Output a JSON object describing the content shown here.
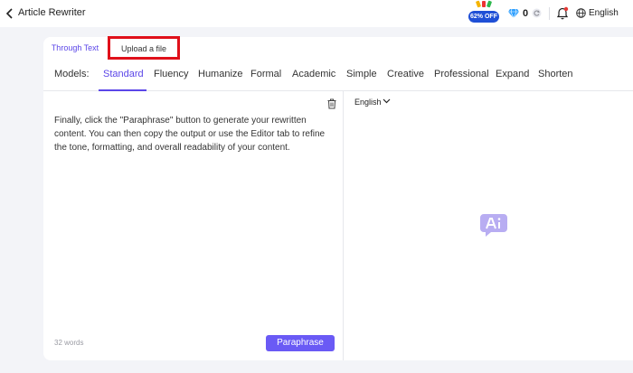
{
  "header": {
    "title": "Article Rewriter",
    "promo_label": "62% OFF",
    "credits": "0",
    "language": "English",
    "icons": [
      "back-icon",
      "diamond-icon",
      "refresh-icon",
      "bell-icon",
      "globe-icon"
    ]
  },
  "source_tabs": [
    {
      "label": "Through Text",
      "active": true
    },
    {
      "label": "Upload a file",
      "active": false
    }
  ],
  "models": {
    "label": "Models:",
    "items": [
      "Standard",
      "Fluency",
      "Humanize",
      "Formal",
      "Academic",
      "Simple",
      "Creative",
      "Professional",
      "Expand",
      "Shorten"
    ],
    "active": "Standard"
  },
  "input": {
    "text": "Finally, click the \"Paraphrase\" button to generate your rewritten content. You can then copy the output or use the Editor tab to refine the tone, formatting, and overall readability of your content.",
    "word_count": "32 words",
    "button": "Paraphrase"
  },
  "output": {
    "language": "English",
    "placeholder_icon": "ai-icon"
  },
  "colors": {
    "accent": "#5b46e8",
    "button": "#6a5af5",
    "highlight": "#e0101a",
    "promo": "#1f4fd6"
  }
}
